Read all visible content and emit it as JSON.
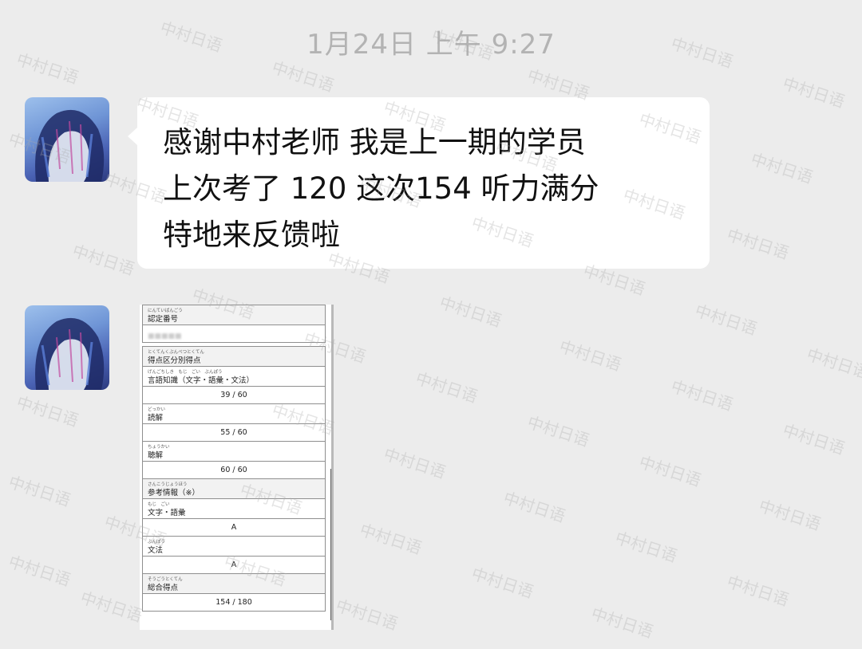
{
  "chat": {
    "timestamp": "1月24日 上午 9:27",
    "message_lines": [
      "感谢中村老师 我是上一期的学员",
      "上次考了 120 这次154 听力满分",
      "特地来反馈啦"
    ]
  },
  "score_report": {
    "cert_number": {
      "ruby": "にんていばんごう",
      "label": "認定番号"
    },
    "section_scores": {
      "ruby": "とくてんくぶんべつとくてん",
      "label": "得点区分別得点"
    },
    "language_knowledge": {
      "ruby": "げんごちしき　もじ　ごい　ぶんぽう",
      "label": "言語知識（文字・語彙・文法）",
      "score": "39 / 60"
    },
    "reading": {
      "ruby": "どっかい",
      "label": "読解",
      "score": "55 / 60"
    },
    "listening": {
      "ruby": "ちょうかい",
      "label": "聴解",
      "score": "60 / 60"
    },
    "reference": {
      "ruby": "さんこうじょうほう",
      "label": "参考情報（※）"
    },
    "vocabulary": {
      "ruby": "もじ　ごい",
      "label": "文字・語彙",
      "grade": "A"
    },
    "grammar": {
      "ruby": "ぶんぽう",
      "label": "文法",
      "grade": "A"
    },
    "total": {
      "ruby": "そうごうとくてん",
      "label": "総合得点",
      "score": "154 / 180"
    }
  },
  "watermark_text": "中村日语"
}
